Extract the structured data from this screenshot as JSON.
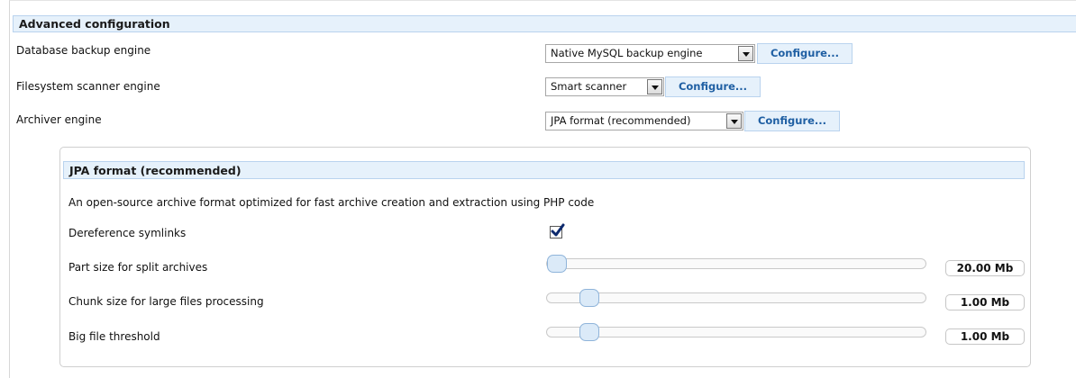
{
  "section": {
    "title": "Advanced configuration"
  },
  "rows": {
    "database": {
      "label": "Database backup engine",
      "value": "Native MySQL backup engine",
      "button": "Configure..."
    },
    "filesystem": {
      "label": "Filesystem scanner engine",
      "value": "Smart scanner",
      "button": "Configure..."
    },
    "archiver": {
      "label": "Archiver engine",
      "value": "JPA format (recommended)",
      "button": "Configure..."
    }
  },
  "panel": {
    "title": "JPA format (recommended)",
    "description": "An open-source archive format optimized for fast archive creation and extraction using PHP code",
    "dereference": {
      "label": "Dereference symlinks",
      "checked": true
    },
    "part_size": {
      "label": "Part size for split archives",
      "value": "20.00 Mb",
      "level": 0.0
    },
    "chunk_size": {
      "label": "Chunk size for large files processing",
      "value": "1.00 Mb",
      "level": 0.09
    },
    "big_file": {
      "label": "Big file threshold",
      "value": "1.00 Mb",
      "level": 0.09
    }
  }
}
